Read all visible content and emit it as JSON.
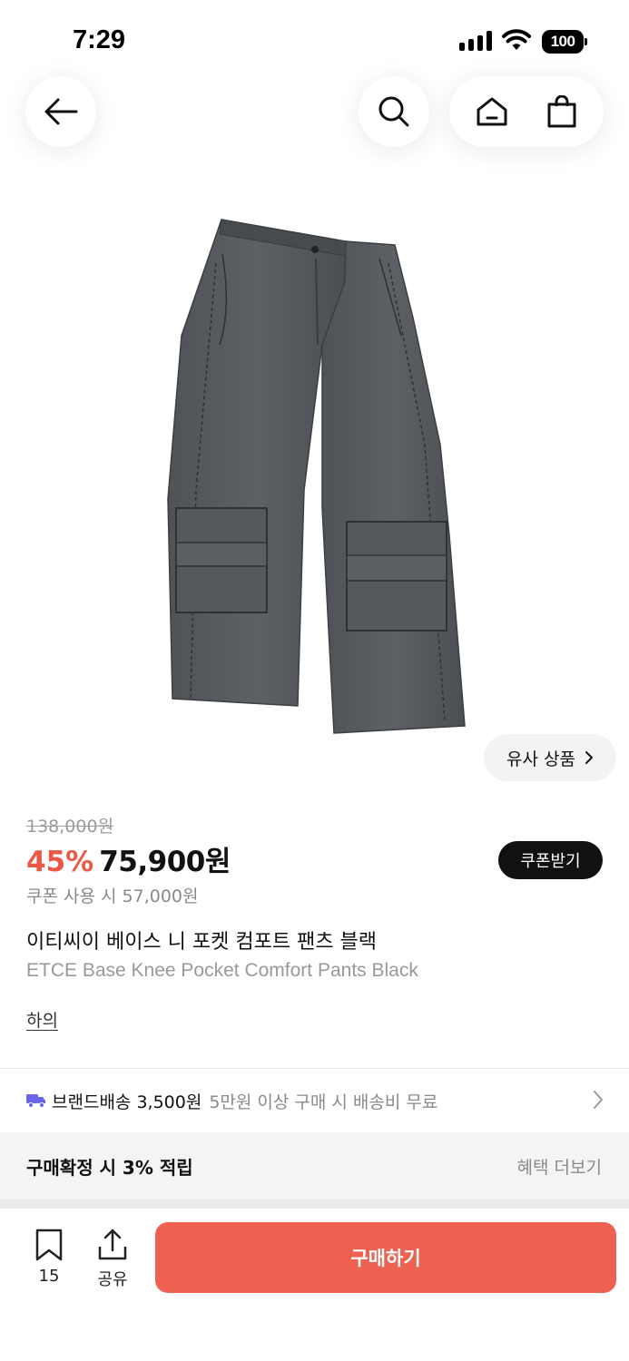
{
  "status_bar": {
    "time": "7:29",
    "battery": "100"
  },
  "nav": {
    "back_icon": "arrow-left-icon",
    "search_icon": "search-icon",
    "home_icon": "home-icon",
    "cart_icon": "shopping-bag-icon"
  },
  "product": {
    "image_label": "pants-photo",
    "similar_label": "유사 상품",
    "original_price": "138,000원",
    "discount_rate": "45%",
    "sale_price": "75,900원",
    "coupon_button": "쿠폰받기",
    "coupon_price": "쿠폰 사용 시 57,000원",
    "title_ko": "이티씨이 베이스 니 포켓 컴포트 팬츠 블랙",
    "title_en": "ETCE Base Knee Pocket Comfort Pants Black",
    "category": "하의"
  },
  "shipping": {
    "label": "브랜드배송 3,500원",
    "note": "5만원 이상 구매 시 배송비 무료"
  },
  "reward": {
    "label": "구매확정 시 3% 적립",
    "more": "혜택 더보기"
  },
  "bottom_bar": {
    "bookmark_count": "15",
    "share_label": "공유",
    "buy_label": "구매하기"
  },
  "colors": {
    "accent": "#ee6150",
    "discount": "#ec5846",
    "shipping_icon": "#6b63e8"
  }
}
